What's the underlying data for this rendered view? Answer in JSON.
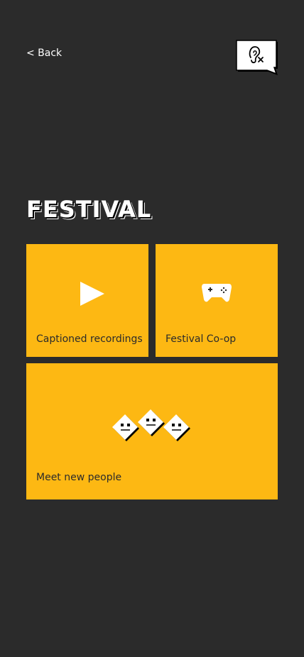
{
  "header": {
    "back_label": "< Back",
    "accessibility_icon": "hearing-captions-icon"
  },
  "page": {
    "title": "FESTIVAL"
  },
  "tiles": [
    {
      "label": "Captioned recordings",
      "icon": "play-icon"
    },
    {
      "label": "Festival Co-op",
      "icon": "gamepad-icon"
    },
    {
      "label": "Meet new people",
      "icon": "faces-icon"
    }
  ],
  "colors": {
    "background": "#2b2b2b",
    "tile": "#fdb813",
    "text_light": "#ffffff",
    "text_dark": "#2b2b2b"
  }
}
